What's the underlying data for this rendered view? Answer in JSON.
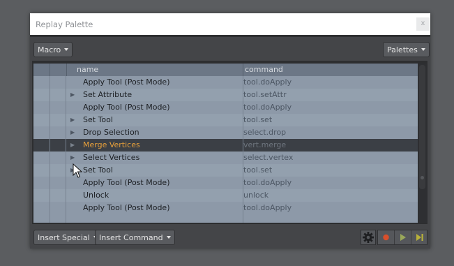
{
  "window": {
    "title": "Replay Palette",
    "close_label": "x"
  },
  "toolbar": {
    "macro_label": "Macro",
    "palettes_label": "Palettes"
  },
  "columns": {
    "name": "name",
    "command": "command"
  },
  "rows": [
    {
      "name": "Apply Tool (Post Mode)",
      "command": "tool.doApply",
      "expandable": false,
      "selected": false
    },
    {
      "name": "Set Attribute",
      "command": "tool.setAttr",
      "expandable": true,
      "selected": false
    },
    {
      "name": "Apply Tool (Post Mode)",
      "command": "tool.doApply",
      "expandable": false,
      "selected": false
    },
    {
      "name": "Set Tool",
      "command": "tool.set",
      "expandable": true,
      "selected": false
    },
    {
      "name": "Drop Selection",
      "command": "select.drop",
      "expandable": true,
      "selected": false
    },
    {
      "name": "Merge Vertices",
      "command": "vert.merge",
      "expandable": true,
      "selected": true
    },
    {
      "name": "Select Vertices",
      "command": "select.vertex",
      "expandable": true,
      "selected": false
    },
    {
      "name": "Set Tool",
      "command": "tool.set",
      "expandable": true,
      "selected": false
    },
    {
      "name": "Apply Tool (Post Mode)",
      "command": "tool.doApply",
      "expandable": false,
      "selected": false
    },
    {
      "name": "Unlock",
      "command": "unlock",
      "expandable": false,
      "selected": false
    },
    {
      "name": "Apply Tool (Post Mode)",
      "command": "tool.doApply",
      "expandable": false,
      "selected": false
    }
  ],
  "bottombar": {
    "insert_special_label": "Insert Special",
    "insert_command_label": "Insert Command",
    "icons": [
      "gear-icon",
      "record-icon",
      "play-icon",
      "step-forward-icon"
    ]
  },
  "colors": {
    "selected_text": "#e7a03b",
    "record": "#d94f2b",
    "play": "#9aa85a",
    "step": "#b8b13a"
  }
}
